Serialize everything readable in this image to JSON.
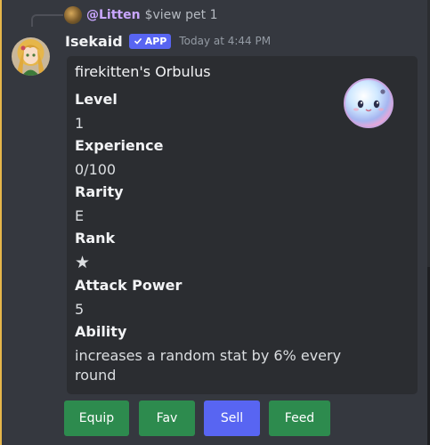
{
  "reply": {
    "username": "@Litten",
    "text": "$view pet 1"
  },
  "message": {
    "author": "Isekaid",
    "app_tag": "APP",
    "timestamp": "Today at 4:44 PM"
  },
  "embed": {
    "title": "firekitten's Orbulus",
    "fields": [
      {
        "name": "Level",
        "value": "1"
      },
      {
        "name": "Experience",
        "value": "0/100"
      },
      {
        "name": "Rarity",
        "value": "E"
      },
      {
        "name": "Rank",
        "value": "★"
      },
      {
        "name": "Attack Power",
        "value": "5"
      },
      {
        "name": "Ability",
        "value": "increases a random stat by 6% every round"
      }
    ]
  },
  "buttons": [
    {
      "label": "Equip",
      "style": "green"
    },
    {
      "label": "Fav",
      "style": "green"
    },
    {
      "label": "Sell",
      "style": "blurple"
    },
    {
      "label": "Feed",
      "style": "green"
    }
  ],
  "colors": {
    "background": "#35383f",
    "embed": "#2b2d31",
    "green_button": "#2d8b4e",
    "blurple_button": "#5865f2",
    "reply_username": "#c9a6ff",
    "left_accent": "#e6b64a"
  },
  "icons": {
    "reply_avatar": "litten-avatar",
    "author_avatar": "anime-girl-avatar",
    "app_tag": "checkmark-icon",
    "thumbnail": "orbulus-pet-image"
  }
}
